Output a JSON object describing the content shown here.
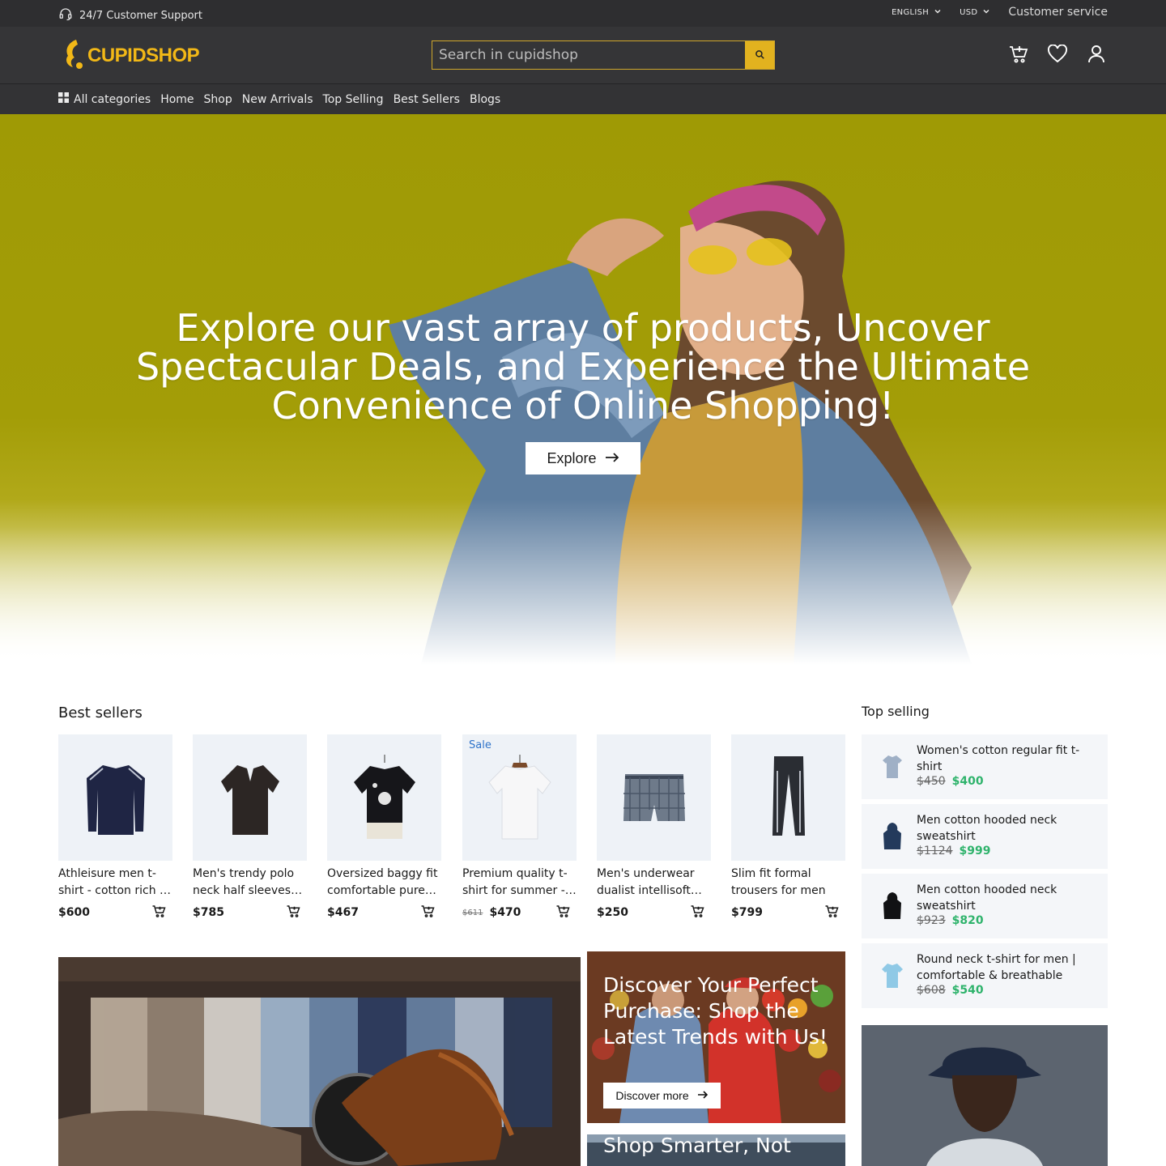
{
  "topbar": {
    "support_text": "24/7 Customer Support",
    "language": "ENGLISH",
    "currency": "USD",
    "customer_service": "Customer service"
  },
  "header": {
    "logo_text": "CUPIDSHOP",
    "search_placeholder": "Search in cupidshop",
    "cart_icon": "cart-plus-icon",
    "wishlist_icon": "heart-icon",
    "account_icon": "user-icon"
  },
  "nav": {
    "all_categories": "All categories",
    "items": [
      "Home",
      "Shop",
      "New Arrivals",
      "Top Selling",
      "Best Sellers",
      "Blogs"
    ]
  },
  "hero": {
    "title": "Explore our vast array of products, Uncover Spectacular Deals, and Experience the Ultimate Convenience of Online Shopping!",
    "button_label": "Explore"
  },
  "best_sellers": {
    "title": "Best sellers",
    "products": [
      {
        "name": "Athleisure men t-shirt - cotton rich …",
        "price": "$600",
        "old_price": "",
        "sale": ""
      },
      {
        "name": "Men's trendy polo neck half sleeves…",
        "price": "$785",
        "old_price": "",
        "sale": ""
      },
      {
        "name": "Oversized baggy fit comfortable pure…",
        "price": "$467",
        "old_price": "",
        "sale": ""
      },
      {
        "name": "Premium quality t-shirt for summer -…",
        "price": "$470",
        "old_price": "$611",
        "sale": "Sale"
      },
      {
        "name": "Men's underwear dualist intellisoft…",
        "price": "$250",
        "old_price": "",
        "sale": ""
      },
      {
        "name": "Slim fit formal trousers for men",
        "price": "$799",
        "old_price": "",
        "sale": ""
      }
    ]
  },
  "top_selling": {
    "title": "Top selling",
    "items": [
      {
        "name": "Women's cotton regular fit t-shirt",
        "old_price": "$450",
        "price": "$400"
      },
      {
        "name": "Men cotton hooded neck sweatshirt",
        "old_price": "$1124",
        "price": "$999"
      },
      {
        "name": "Men cotton hooded neck sweatshirt",
        "old_price": "$923",
        "price": "$820"
      },
      {
        "name": "Round neck t-shirt for men | comfortable & breathable",
        "old_price": "$608",
        "price": "$540"
      }
    ]
  },
  "promos": {
    "mid_title": "Discover Your Perfect Purchase: Shop the Latest Trends with Us!",
    "mid_button": "Discover more",
    "mid2_title": "Shop Smarter, Not"
  },
  "colors": {
    "accent": "#e2b21f",
    "hero_bg": "#a09a06",
    "dark_bg": "#343436",
    "sale_price": "#2fb36c"
  }
}
